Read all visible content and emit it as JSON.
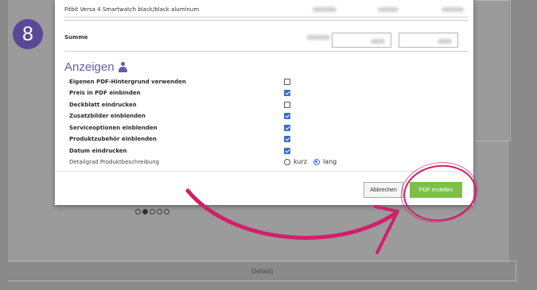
{
  "step_badge": "8",
  "modal": {
    "product_name": "Fitbit Versa 4 Smartwatch black/black aluminum",
    "summe_label": "Summe",
    "section_title": "Anzeigen",
    "section_icon": "person-icon",
    "options": [
      {
        "label": "Eigenen PDF-Hintergrund verwenden",
        "checked": false
      },
      {
        "label": "Preis in PDF einbinden",
        "checked": true
      },
      {
        "label": "Deckblatt eindrucken",
        "checked": false
      },
      {
        "label": "Zusatzbilder einblenden",
        "checked": true
      },
      {
        "label": "Serviceoptionen einblenden",
        "checked": true
      },
      {
        "label": "Produktzubehör einblenden",
        "checked": true
      },
      {
        "label": "Datum eindrucken",
        "checked": true
      }
    ],
    "detail_level": {
      "label": "Detailgrad Produktbeschreibung",
      "option_short": "kurz",
      "option_long": "lang",
      "selected": "lang"
    },
    "cancel_label": "Abbrechen",
    "create_pdf_label": "PDF erstellen"
  },
  "background": {
    "details_label": "Details",
    "carousel_active_index": 1,
    "carousel_count": 5
  },
  "colors": {
    "badge": "#5a4897",
    "title": "#6b5aa3",
    "primary_button": "#7cc04b",
    "checkbox": "#3b6fc4",
    "annotation": "#d0206b"
  }
}
